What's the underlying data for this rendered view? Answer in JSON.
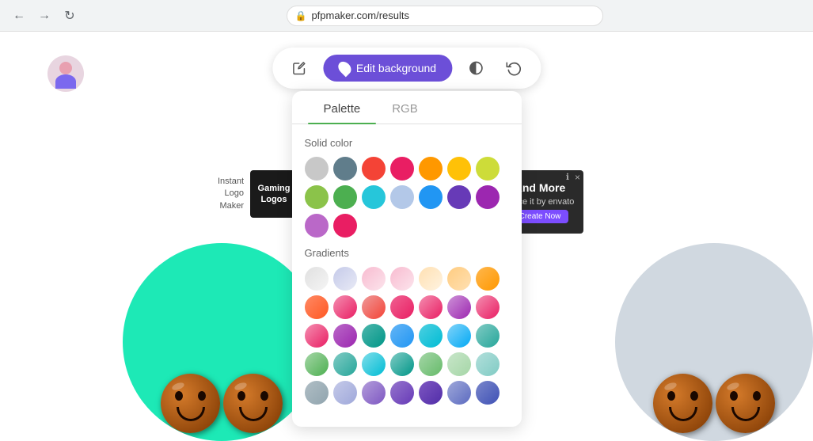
{
  "browser": {
    "url": "pfpmaker.com/results",
    "back_label": "←",
    "forward_label": "→",
    "reload_label": "↻"
  },
  "toolbar": {
    "edit_bg_label": "Edit background",
    "pencil_icon": "✏",
    "droplet_icon": "💧",
    "contrast_icon": "◑",
    "reset_icon": "↺"
  },
  "popup": {
    "tab_palette": "Palette",
    "tab_rgb": "RGB",
    "solid_color_label": "Solid color",
    "gradients_label": "Gradients"
  },
  "solid_colors": [
    "#c8c8c8",
    "#607d8b",
    "#f44336",
    "#e91e63",
    "#ff9800",
    "#ffc107",
    "#cddc39",
    "#8bc34a",
    "#4caf50",
    "#26c6da",
    "#b3c8e8",
    "#2196f3",
    "#673ab7",
    "#9c27b0",
    "#ba68c8",
    "#e91e63"
  ],
  "gradients": [
    [
      "#e0e0e0",
      "#f5f5f5"
    ],
    [
      "#c5cae9",
      "#e8eaf6"
    ],
    [
      "#f8bbd0",
      "#fce4ec"
    ],
    [
      "#f48fb1",
      "#f8bbd0"
    ],
    [
      "#ffe0b2",
      "#fff3e0"
    ],
    [
      "#ffcc80",
      "#ffe0b2"
    ],
    [
      "#ffb74d",
      "#ff9800"
    ],
    [
      "#ff8a65",
      "#ff5722"
    ],
    [
      "#f48fb1",
      "#e91e63"
    ],
    [
      "#ef9a9a",
      "#f44336"
    ],
    [
      "#f06292",
      "#e91e63"
    ],
    [
      "#f48fb1",
      "#e91e63"
    ],
    [
      "#ce93d8",
      "#9c27b0"
    ],
    [
      "#f48fb1",
      "#e91e63"
    ],
    [
      "#f48fb1",
      "#e91e63"
    ],
    [
      "#ba68c8",
      "#9c27b0"
    ],
    [
      "#4db6ac",
      "#009688"
    ],
    [
      "#64b5f6",
      "#2196f3"
    ],
    [
      "#4dd0e1",
      "#00bcd4"
    ],
    [
      "#81d4fa",
      "#03a9f4"
    ],
    [
      "#80cbc4",
      "#26a69a"
    ],
    [
      "#a5d6a7",
      "#4caf50"
    ],
    [
      "#80cbc4",
      "#26a69a"
    ],
    [
      "#80deea",
      "#00bcd4"
    ],
    [
      "#80cbc4",
      "#009688"
    ],
    [
      "#a5d6a7",
      "#66bb6a"
    ],
    [
      "#c8e6c9",
      "#a5d6a7"
    ],
    [
      "#b2dfdb",
      "#80cbc4"
    ],
    [
      "#b0bec5",
      "#90a4ae"
    ],
    [
      "#c5cae9",
      "#9fa8da"
    ],
    [
      "#b39ddb",
      "#7e57c2"
    ],
    [
      "#9575cd",
      "#673ab7"
    ],
    [
      "#7e57c2",
      "#512da8"
    ],
    [
      "#9fa8da",
      "#5c6bc0"
    ],
    [
      "#7986cb",
      "#3f51b5"
    ]
  ],
  "ad": {
    "and_more_text": "And More",
    "place_it_label": "Place it by envato",
    "create_now_label": "Create Now",
    "close_icon": "×",
    "info_icon": "ℹ"
  },
  "gaming_ad": {
    "instant_text": "Instant\nLogo\nMaker",
    "gaming_label": "Gaming\nLogos"
  },
  "avatar": {
    "alt": "User avatar"
  }
}
